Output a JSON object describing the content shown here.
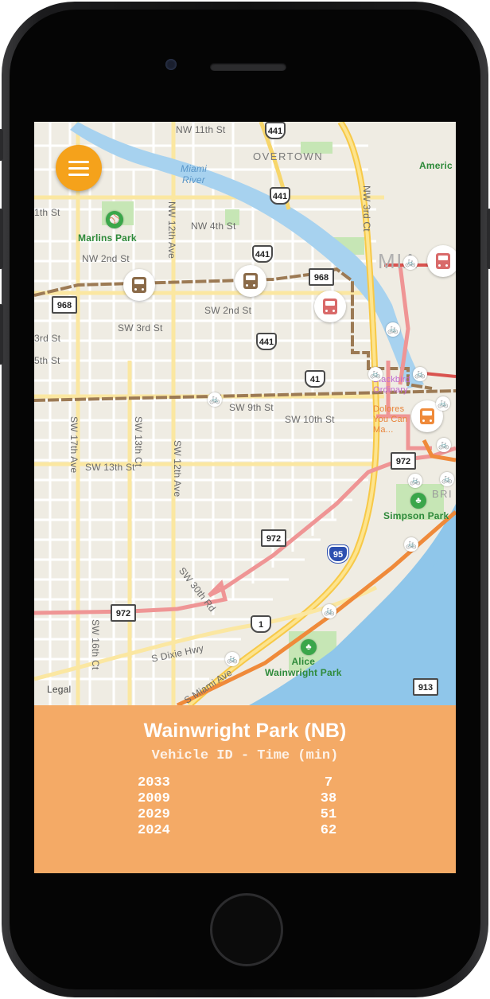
{
  "app": {
    "menu_icon": "hamburger-menu-icon",
    "accent_color": "#f5a21b",
    "panel_color": "#f4aa66"
  },
  "map": {
    "streets": {
      "nw11": "NW 11th St",
      "nw4": "NW 4th St",
      "nw2": "NW 2nd St",
      "sw2": "SW 2nd St",
      "sw3": "SW 3rd St",
      "sw3b": "3rd St",
      "st5": "5th St",
      "st1": "1th St",
      "sw9": "SW 9th St",
      "sw10": "SW 10th St",
      "sw13": "SW 13th St",
      "nw12ave": "NW 12th Ave",
      "sw12ave": "SW 12th Ave",
      "sw17ave": "SW 17th Ave",
      "sw13ct": "SW 13th Ct",
      "sw16ct": "SW 16th Ct",
      "sw30rd": "SW 30th Rd",
      "nw3ct": "NW 3rd Ct",
      "sdixie": "S Dixie Hwy",
      "smiami": "S Miami Ave"
    },
    "places": {
      "overtown": "OVERTOWN",
      "river": "Miami\nRiver",
      "marlins": "Marlins Park",
      "simpson": "Simpson Park",
      "alice": "Alice\nWainwright Park",
      "america": "Americ",
      "mia": "MIA",
      "bri": "BRI",
      "blackbird": "Blackbird\nOrdinary",
      "dolores": "Dolores\nYou Can\nMa..."
    },
    "shields": {
      "s441a": "441",
      "s441b": "441",
      "s441c": "441",
      "s441d": "441",
      "s41": "41",
      "s968a": "968",
      "s968b": "968",
      "s972a": "972",
      "s972b": "972",
      "s972c": "972",
      "s913": "913",
      "s1": "1",
      "i95": "95"
    },
    "legal": "Legal",
    "route_colors": {
      "brown": "#9c7a54",
      "pink": "#ef9595",
      "orange": "#ef8a3a",
      "red": "#d9534f"
    }
  },
  "arrivals": {
    "stop_name": "Wainwright Park (NB)",
    "header": "Vehicle ID - Time (min)",
    "rows": [
      {
        "vehicle_id": "2033",
        "time": "7"
      },
      {
        "vehicle_id": "2009",
        "time": "38"
      },
      {
        "vehicle_id": "2029",
        "time": "51"
      },
      {
        "vehicle_id": "2024",
        "time": "62"
      }
    ]
  }
}
